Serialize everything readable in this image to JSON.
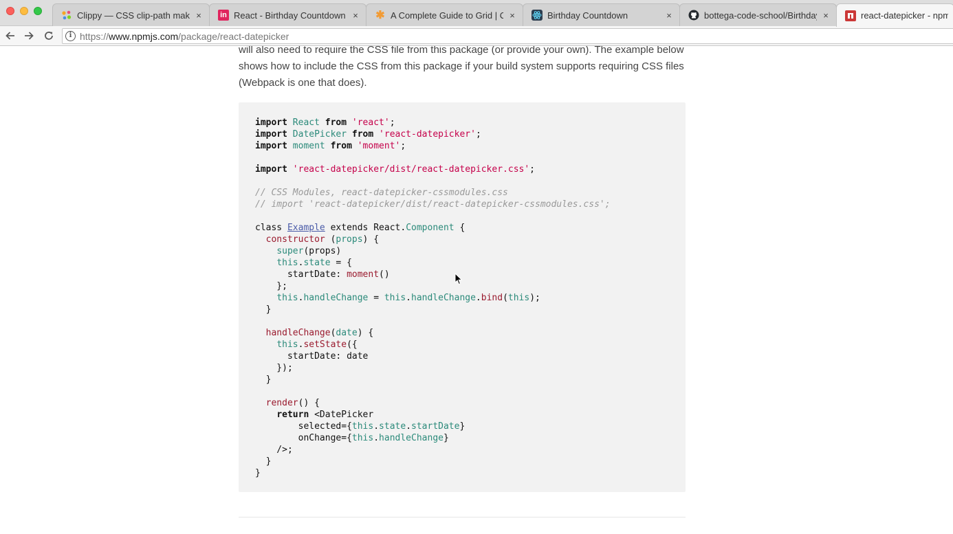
{
  "browser": {
    "tabs": [
      {
        "title": "Clippy — CSS clip-path maker",
        "favicon": "clippy-dots-icon",
        "color": "#e8a33d",
        "active": false
      },
      {
        "title": "React - Birthday Countdown P",
        "favicon": "invision-icon",
        "color": "#e0245e",
        "active": false
      },
      {
        "title": "A Complete Guide to Grid | CS",
        "favicon": "css-tricks-star-icon",
        "color": "#f29b34",
        "active": false
      },
      {
        "title": "Birthday Countdown",
        "favicon": "react-atom-icon",
        "color": "#2c3e50",
        "active": false
      },
      {
        "title": "bottega-code-school/Birthday",
        "favicon": "github-icon",
        "color": "#24292e",
        "active": false
      },
      {
        "title": "react-datepicker - npm",
        "favicon": "npm-icon",
        "color": "#cb3837",
        "active": true
      }
    ],
    "close_glyph": "×",
    "url": {
      "scheme": "https://",
      "host": "www.npmjs.com",
      "path": "/package/react-datepicker"
    }
  },
  "page": {
    "intro_lines": [
      "will also need to require the CSS file from this package (or provide your own). The example below",
      "shows how to include the CSS from this package if your build system supports requiring CSS files",
      "(Webpack is one that does)."
    ],
    "code": {
      "language": "javascript",
      "tokens": {
        "import": "import",
        "from": "from",
        "React": "React",
        "react_str": "'react'",
        "DatePicker": "DatePicker",
        "datepicker_str": "'react-datepicker'",
        "moment": "moment",
        "moment_str": "'moment'",
        "css_str": "'react-datepicker/dist/react-datepicker.css'",
        "comment1": "// CSS Modules, react-datepicker-cssmodules.css",
        "comment2": "// import 'react-datepicker/dist/react-datepicker-cssmodules.css';",
        "class": "class",
        "Example": "Example",
        "extends": "extends",
        "ReactDot": "React.",
        "Component": "Component",
        "constructor": "constructor",
        "props": "props",
        "super": "super",
        "this": "this",
        "state": "state",
        "startDate": "startDate",
        "moment_call": "moment",
        "handleChange": "handleChange",
        "bind": "bind",
        "date": "date",
        "setState": "setState",
        "render": "render",
        "return": "return",
        "DatePickerTag": "<DatePicker",
        "selected": "selected",
        "onChange": "onChange"
      }
    }
  }
}
